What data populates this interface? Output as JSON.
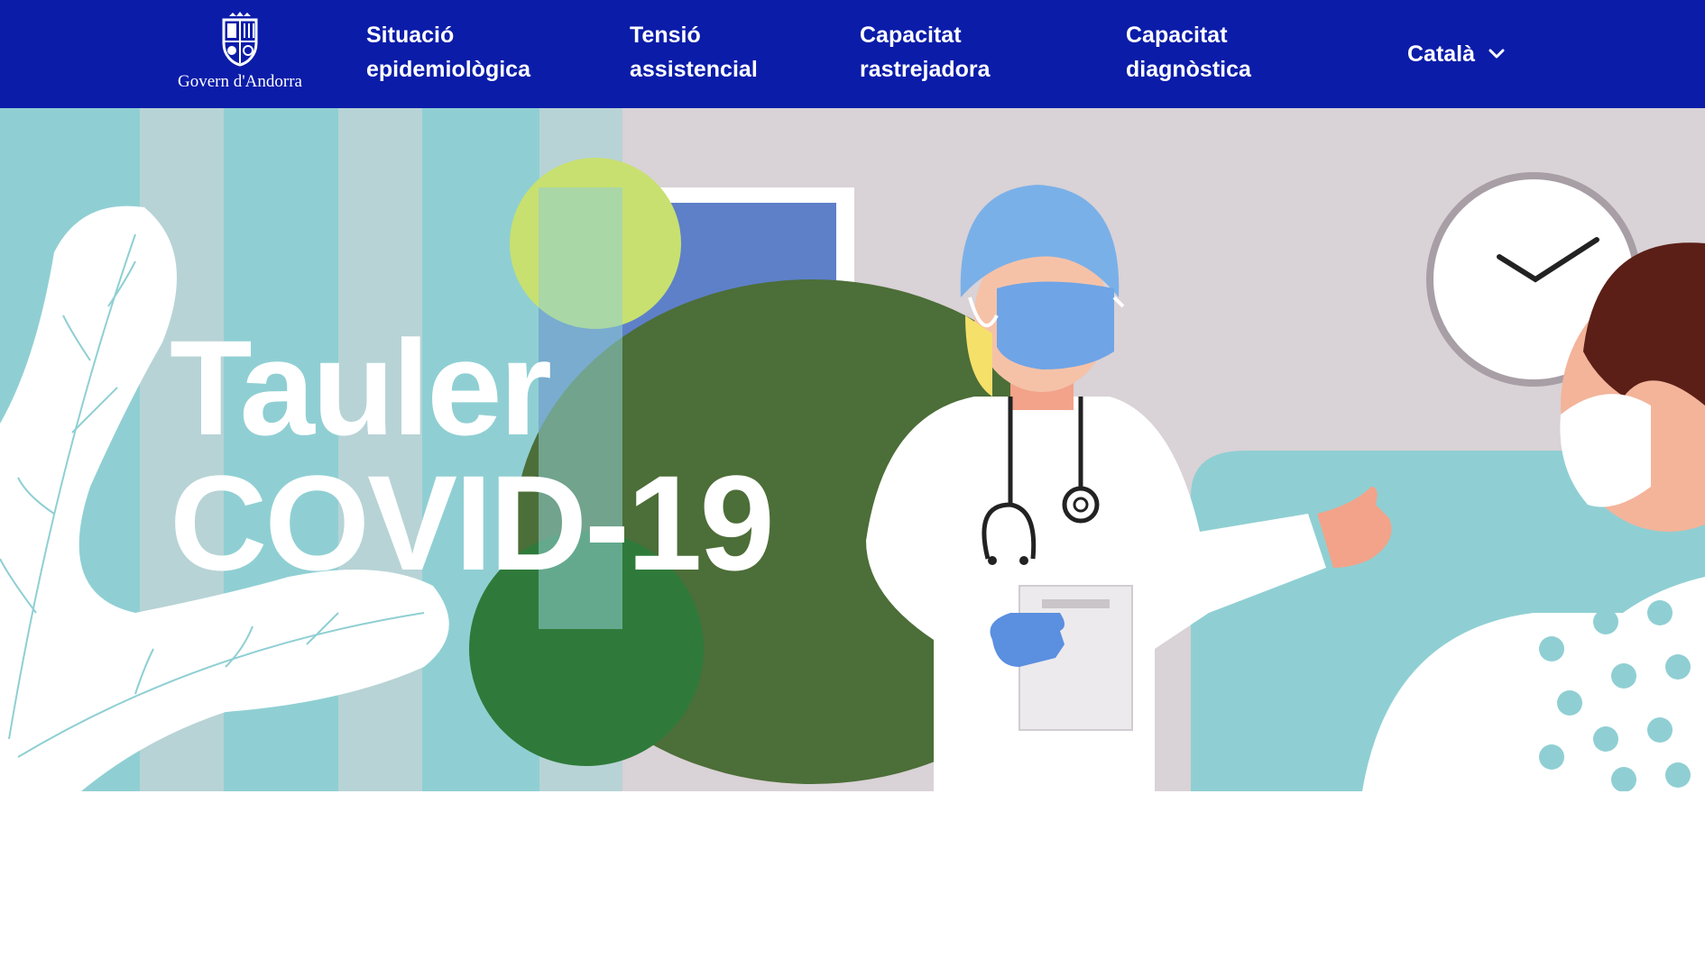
{
  "header": {
    "logo": {
      "text": "Govern d'Andorra",
      "icon": "coat-of-arms-icon"
    },
    "nav": [
      {
        "line1": "Situació",
        "line2": "epidemiològica"
      },
      {
        "line1": "Tensió",
        "line2": "assistencial"
      },
      {
        "line1": "Capacitat",
        "line2": "rastrejadora"
      },
      {
        "line1": "Capacitat",
        "line2": "diagnòstica"
      }
    ],
    "language": {
      "label": "Català",
      "icon": "chevron-down-icon"
    }
  },
  "hero": {
    "title_line1": "Tauler",
    "title_line2": "COVID-19",
    "illustration": "doctor-with-patient-illustration"
  },
  "colors": {
    "nav_bg": "#0b1ca9",
    "teal": "#8fcfd3",
    "wall": "#d9d2d6",
    "white": "#ffffff"
  }
}
